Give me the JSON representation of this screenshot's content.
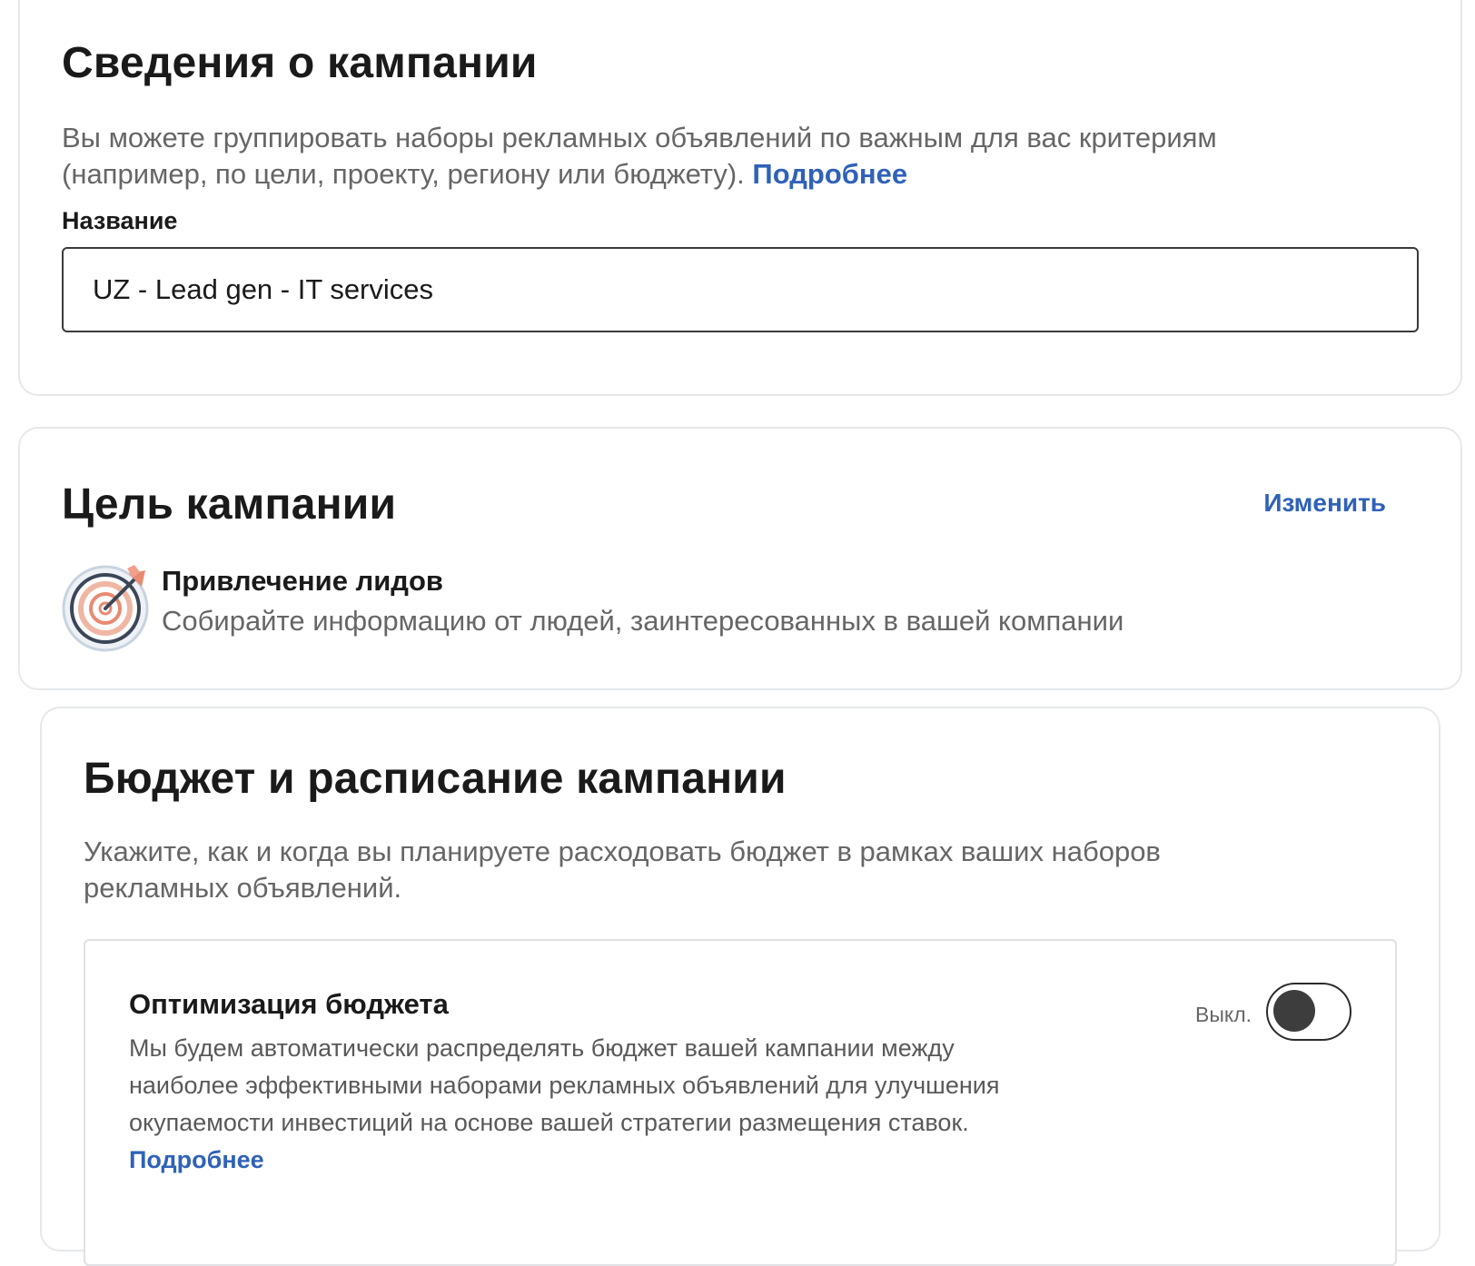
{
  "campaign_details": {
    "title": "Сведения о кампании",
    "description": "Вы можете группировать наборы рекламных объявлений по важным для вас критериям (например, по цели, проекту, региону или бюджету).",
    "learn_more": "Подробнее",
    "name_label": "Название",
    "name_value": "UZ - Lead gen - IT services"
  },
  "campaign_goal": {
    "title": "Цель кампании",
    "edit_label": "Изменить",
    "goal_name": "Привлечение лидов",
    "goal_description": "Собирайте информацию от людей, заинтересованных в вашей компании",
    "icon": "target-icon"
  },
  "budget_schedule": {
    "title": "Бюджет и расписание кампании",
    "description": "Укажите, как и когда вы планируете расходовать бюджет в рамках ваших наборов рекламных объявлений.",
    "optimization": {
      "title": "Оптимизация бюджета",
      "description": "Мы будем автоматически распределять бюджет вашей кампании между наиболее эффективными наборами рекламных объявлений для улучшения окупаемости инвестиций на основе вашей стратегии размещения ставок.",
      "learn_more": "Подробнее",
      "toggle_state_label": "Выкл.",
      "toggle_on": false
    }
  },
  "colors": {
    "link": "#2f62b8",
    "border": "#e6e8eb",
    "muted_text": "#666666"
  }
}
